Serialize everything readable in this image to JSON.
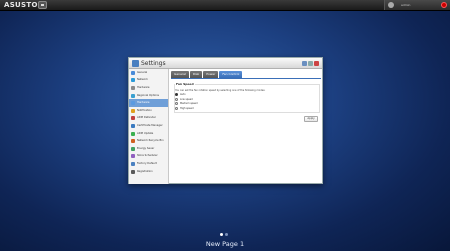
{
  "topbar": {
    "logo_text": "ASUSTOR",
    "user_label": "admin"
  },
  "window": {
    "title": "Settings"
  },
  "sidebar": {
    "items": [
      {
        "label": "General",
        "color": "#4a8bd8"
      },
      {
        "label": "Network",
        "color": "#2a9ad8"
      },
      {
        "label": "Hardware",
        "color": "#8a8a8a"
      },
      {
        "label": "Regional Options",
        "color": "#3aa0d0"
      },
      {
        "label": "Hardware",
        "color": "#5a9ae0"
      },
      {
        "label": "Notification",
        "color": "#e0a020"
      },
      {
        "label": "ADM Defender",
        "color": "#c04040"
      },
      {
        "label": "Certificate Manager",
        "color": "#3a7ac0"
      },
      {
        "label": "ADM Update",
        "color": "#3ab050"
      },
      {
        "label": "Network Recycle Bin",
        "color": "#d06020"
      },
      {
        "label": "Energy Saver",
        "color": "#40a060"
      },
      {
        "label": "Store Scheduler",
        "color": "#9060c0"
      },
      {
        "label": "Factory Default",
        "color": "#4a80c0"
      },
      {
        "label": "Registration",
        "color": "#5a5a5a"
      }
    ],
    "active_index": 4
  },
  "tabs": [
    {
      "label": "General"
    },
    {
      "label": "Disk"
    },
    {
      "label": "Power"
    },
    {
      "label": "Fan Control"
    }
  ],
  "active_tab": 3,
  "fan": {
    "section_title": "Fan Speed",
    "description": "You can set the fan rotation speed by selecting one of the following modes:",
    "options": [
      {
        "label": "Auto",
        "checked": true
      },
      {
        "label": "Low speed",
        "checked": false
      },
      {
        "label": "Medium speed",
        "checked": false
      },
      {
        "label": "High speed",
        "checked": false
      }
    ],
    "apply_label": "Apply"
  },
  "page": {
    "label": "New Page 1"
  }
}
